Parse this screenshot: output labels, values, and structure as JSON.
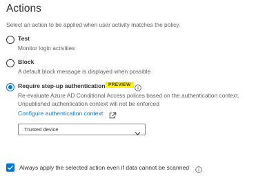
{
  "section": {
    "title": "Actions",
    "subtitle": "Select an action to be applied when user activity matches the policy."
  },
  "options": [
    {
      "label": "Test",
      "description": "Monitor login activities",
      "selected": false
    },
    {
      "label": "Block",
      "description": "A default block message is displayed when possible",
      "selected": false
    },
    {
      "label": "Require step-up authentication",
      "badge": "PREVIEW",
      "description_line1": "Re-evaluate Azure AD Conditional Access polices based on the authentication context.",
      "description_line2": "Unpublished authentication context will not be enforced",
      "selected": true
    }
  ],
  "configure_link": "Configure authentication context",
  "dropdown": {
    "selected": "Trusted device"
  },
  "always_apply": {
    "label": "Always apply the selected action even if data cannot be scanned",
    "checked": true
  },
  "colors": {
    "accent": "#0078d4",
    "badge": "#fff100",
    "text": "#323130",
    "secondary_text": "#605e5c"
  },
  "icons": [
    "info-icon",
    "external-link-icon",
    "chevron-down-icon",
    "checkmark-icon"
  ]
}
